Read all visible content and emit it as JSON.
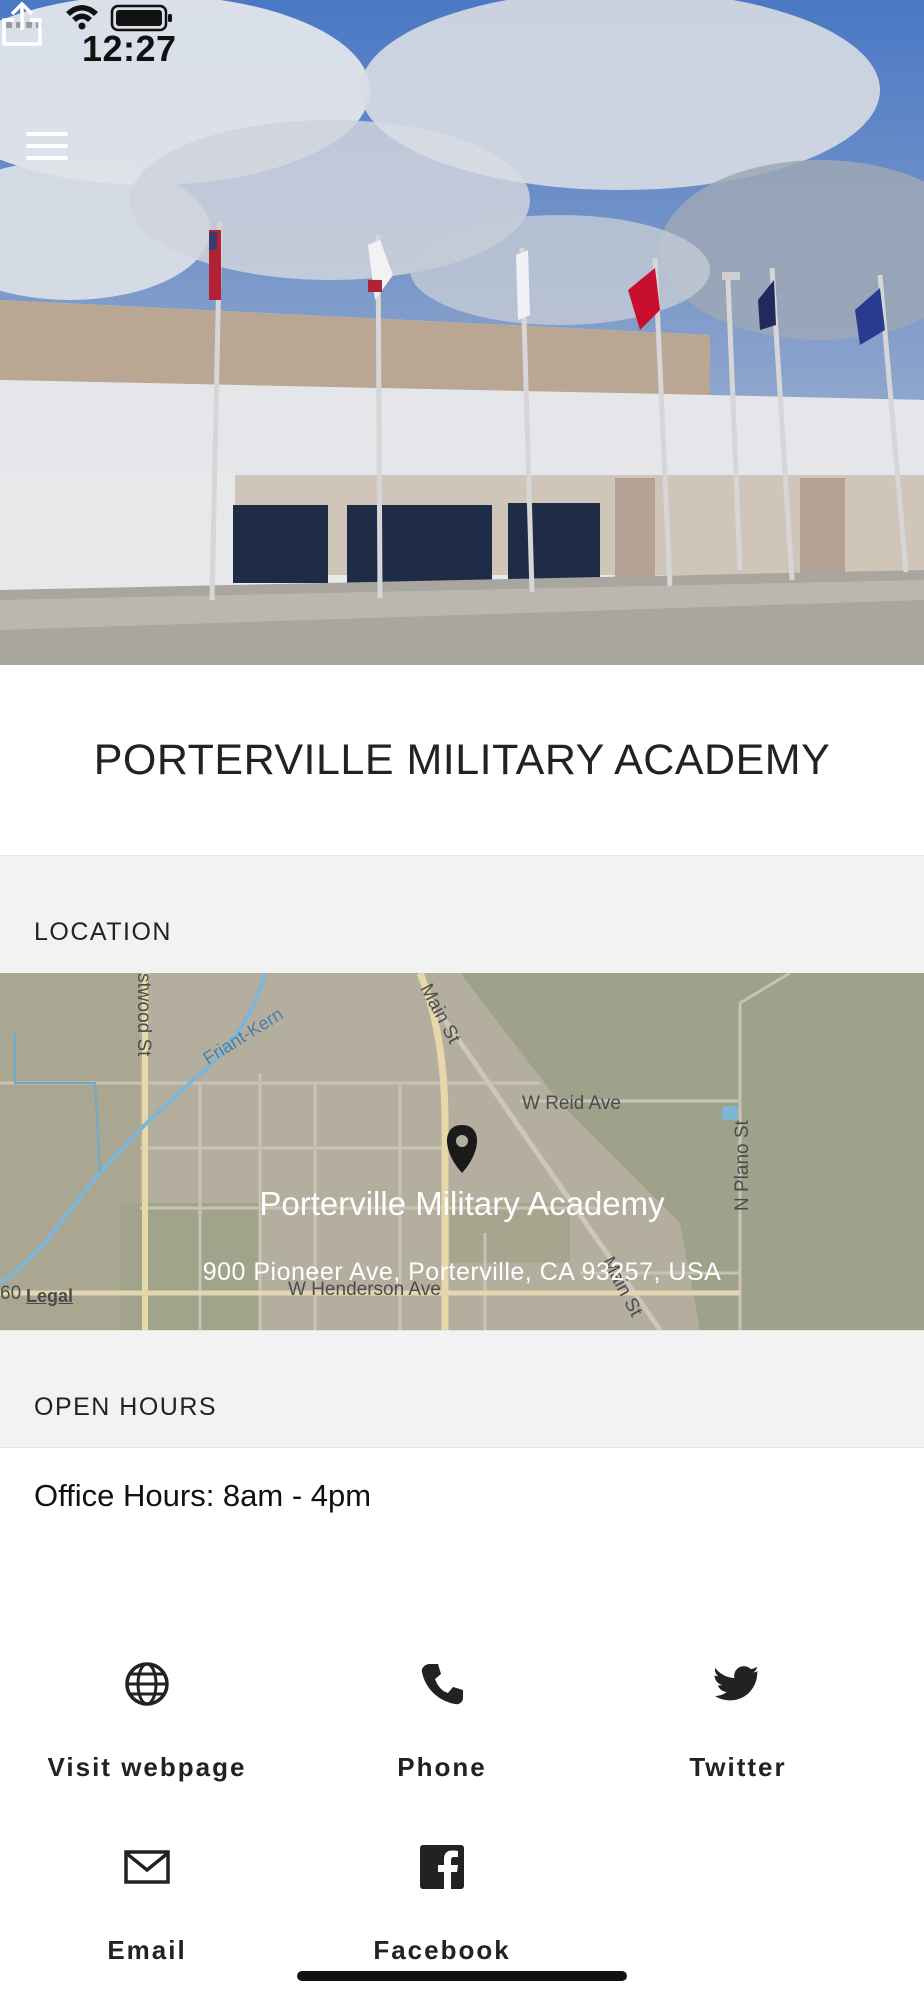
{
  "status_bar": {
    "time": "12:27"
  },
  "header": {
    "menu_icon": "hamburger-menu-icon",
    "share_icon": "share-icon"
  },
  "place": {
    "title": "PORTERVILLE MILITARY ACADEMY"
  },
  "location": {
    "section_label": "LOCATION",
    "map_name": "Porterville Military Academy",
    "address": "900 Pioneer Ave, Porterville, CA 93257, USA",
    "legal_label": "Legal",
    "streets": [
      "Main St",
      "W Reid Ave",
      "N Plano St",
      "W Henderson Ave",
      "Friant-Kern",
      "stwood St",
      "Main St",
      "60"
    ]
  },
  "hours": {
    "section_label": "OPEN HOURS",
    "text": "Office Hours: 8am - 4pm"
  },
  "actions": [
    {
      "label": "Visit webpage",
      "icon": "globe-icon"
    },
    {
      "label": "Phone",
      "icon": "phone-icon"
    },
    {
      "label": "Twitter",
      "icon": "twitter-icon"
    },
    {
      "label": "Email",
      "icon": "email-icon"
    },
    {
      "label": "Facebook",
      "icon": "facebook-icon"
    }
  ],
  "colors": {
    "section_bg": "#f2f2f2",
    "text": "#222222",
    "map_bg": "#b3ad9c"
  }
}
